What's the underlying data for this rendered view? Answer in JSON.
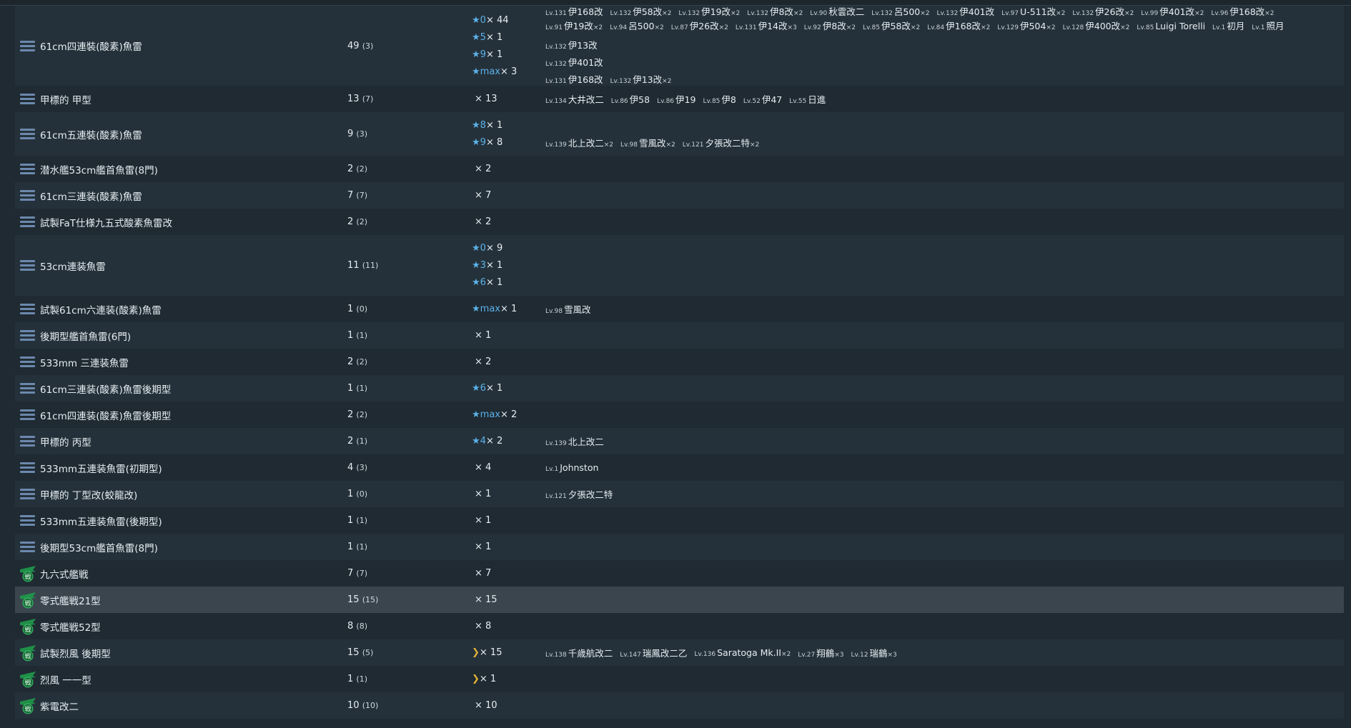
{
  "rows": [
    {
      "icon": "torpedo",
      "name": "61cm四連裝(酸素)魚雷",
      "count": "49",
      "paren": "(3)",
      "height": 112,
      "levels": [
        {
          "kind": "star",
          "level": "0",
          "mult": "44"
        },
        {
          "kind": "star",
          "level": "5",
          "mult": "1"
        },
        {
          "kind": "star",
          "level": "9",
          "mult": "1"
        },
        {
          "kind": "star",
          "level": "max",
          "mult": "3"
        }
      ],
      "ships": [
        [
          {
            "lv": "Lv.131",
            "name": "伊168改"
          },
          {
            "lv": "Lv.132",
            "name": "伊58改",
            "x": "×2"
          },
          {
            "lv": "Lv.132",
            "name": "伊19改",
            "x": "×2"
          },
          {
            "lv": "Lv.132",
            "name": "伊8改",
            "x": "×2"
          },
          {
            "lv": "Lv.90",
            "name": "秋雲改二"
          },
          {
            "lv": "Lv.132",
            "name": "呂500",
            "x": "×2"
          },
          {
            "lv": "Lv.132",
            "name": "伊401改"
          },
          {
            "lv": "Lv.97",
            "name": "U-511改",
            "x": "×2"
          },
          {
            "lv": "Lv.132",
            "name": "伊26改",
            "x": "×2"
          },
          {
            "lv": "Lv.99",
            "name": "伊401改",
            "x": "×2"
          },
          {
            "lv": "Lv.96",
            "name": "伊168改",
            "x": "×2"
          },
          {
            "lv": "Lv.91",
            "name": "伊19改",
            "x": "×2"
          },
          {
            "lv": "Lv.94",
            "name": "呂500",
            "x": "×2"
          },
          {
            "lv": "Lv.87",
            "name": "伊26改",
            "x": "×2"
          },
          {
            "lv": "Lv.131",
            "name": "伊14改",
            "x": "×3"
          },
          {
            "lv": "Lv.92",
            "name": "伊8改",
            "x": "×2"
          },
          {
            "lv": "Lv.85",
            "name": "伊58改",
            "x": "×2"
          },
          {
            "lv": "Lv.84",
            "name": "伊168改",
            "x": "×2"
          },
          {
            "lv": "Lv.129",
            "name": "伊504",
            "x": "×2"
          },
          {
            "lv": "Lv.128",
            "name": "伊400改",
            "x": "×2"
          },
          {
            "lv": "Lv.85",
            "name": "Luigi Torelli"
          },
          {
            "lv": "Lv.1",
            "name": "初月"
          },
          {
            "lv": "Lv.1",
            "name": "照月"
          }
        ],
        [
          {
            "lv": "Lv.132",
            "name": "伊13改"
          }
        ],
        [
          {
            "lv": "Lv.132",
            "name": "伊401改"
          }
        ],
        [
          {
            "lv": "Lv.131",
            "name": "伊168改"
          },
          {
            "lv": "Lv.132",
            "name": "伊13改",
            "x": "×2"
          }
        ]
      ]
    },
    {
      "icon": "torpedo",
      "name": "甲標的 甲型",
      "count": "13",
      "paren": "(7)",
      "height": 37,
      "levels": [
        {
          "kind": "plain",
          "level": "",
          "mult": "13"
        }
      ],
      "ships": [
        [
          {
            "lv": "Lv.134",
            "name": "大井改二"
          },
          {
            "lv": "Lv.86",
            "name": "伊58"
          },
          {
            "lv": "Lv.86",
            "name": "伊19"
          },
          {
            "lv": "Lv.85",
            "name": "伊8"
          },
          {
            "lv": "Lv.52",
            "name": "伊47"
          },
          {
            "lv": "Lv.55",
            "name": "日進"
          }
        ]
      ]
    },
    {
      "icon": "torpedo",
      "name": "61cm五連裝(酸素)魚雷",
      "count": "9",
      "paren": "(3)",
      "height": 61,
      "levels": [
        {
          "kind": "star",
          "level": "8",
          "mult": "1"
        },
        {
          "kind": "star",
          "level": "9",
          "mult": "8"
        }
      ],
      "ships": [
        [],
        [
          {
            "lv": "Lv.139",
            "name": "北上改二",
            "x": "×2"
          },
          {
            "lv": "Lv.98",
            "name": "雪風改",
            "x": "×2"
          },
          {
            "lv": "Lv.121",
            "name": "夕張改二特",
            "x": "×2"
          }
        ]
      ]
    },
    {
      "icon": "torpedo",
      "name": "潜水艦53cm艦首魚雷(8門)",
      "count": "2",
      "paren": "(2)",
      "height": 37,
      "levels": [
        {
          "kind": "plain",
          "level": "",
          "mult": "2"
        }
      ],
      "ships": [
        []
      ]
    },
    {
      "icon": "torpedo",
      "name": "61cm三連装(酸素)魚雷",
      "count": "7",
      "paren": "(7)",
      "height": 37,
      "levels": [
        {
          "kind": "plain",
          "level": "",
          "mult": "7"
        }
      ],
      "ships": [
        []
      ]
    },
    {
      "icon": "torpedo",
      "name": "試製FaT仕様九五式酸素魚雷改",
      "count": "2",
      "paren": "(2)",
      "height": 37,
      "levels": [
        {
          "kind": "plain",
          "level": "",
          "mult": "2"
        }
      ],
      "ships": [
        []
      ]
    },
    {
      "icon": "torpedo",
      "name": "53cm連装魚雷",
      "count": "11",
      "paren": "(11)",
      "height": 85,
      "levels": [
        {
          "kind": "star",
          "level": "0",
          "mult": "9"
        },
        {
          "kind": "star",
          "level": "3",
          "mult": "1"
        },
        {
          "kind": "star",
          "level": "6",
          "mult": "1"
        }
      ],
      "ships": [
        [],
        [],
        []
      ]
    },
    {
      "icon": "torpedo",
      "name": "試製61cm六連装(酸素)魚雷",
      "count": "1",
      "paren": "(0)",
      "height": 37,
      "levels": [
        {
          "kind": "star",
          "level": "max",
          "mult": "1"
        }
      ],
      "ships": [
        [
          {
            "lv": "Lv.98",
            "name": "雪風改"
          }
        ]
      ]
    },
    {
      "icon": "torpedo",
      "name": "後期型艦首魚雷(6門)",
      "count": "1",
      "paren": "(1)",
      "height": 37,
      "levels": [
        {
          "kind": "plain",
          "level": "",
          "mult": "1"
        }
      ],
      "ships": [
        []
      ]
    },
    {
      "icon": "torpedo",
      "name": "533mm 三連装魚雷",
      "count": "2",
      "paren": "(2)",
      "height": 37,
      "levels": [
        {
          "kind": "plain",
          "level": "",
          "mult": "2"
        }
      ],
      "ships": [
        []
      ]
    },
    {
      "icon": "torpedo",
      "name": "61cm三連装(酸素)魚雷後期型",
      "count": "1",
      "paren": "(1)",
      "height": 37,
      "levels": [
        {
          "kind": "star",
          "level": "6",
          "mult": "1"
        }
      ],
      "ships": [
        []
      ]
    },
    {
      "icon": "torpedo",
      "name": "61cm四連装(酸素)魚雷後期型",
      "count": "2",
      "paren": "(2)",
      "height": 37,
      "levels": [
        {
          "kind": "star",
          "level": "max",
          "mult": "2"
        }
      ],
      "ships": [
        []
      ]
    },
    {
      "icon": "torpedo",
      "name": "甲標的 丙型",
      "count": "2",
      "paren": "(1)",
      "height": 37,
      "levels": [
        {
          "kind": "star",
          "level": "4",
          "mult": "2"
        }
      ],
      "ships": [
        [
          {
            "lv": "Lv.139",
            "name": "北上改二"
          }
        ]
      ]
    },
    {
      "icon": "torpedo",
      "name": "533mm五連装魚雷(初期型)",
      "count": "4",
      "paren": "(3)",
      "height": 37,
      "levels": [
        {
          "kind": "plain",
          "level": "",
          "mult": "4"
        }
      ],
      "ships": [
        [
          {
            "lv": "Lv.1",
            "name": "Johnston"
          }
        ]
      ]
    },
    {
      "icon": "torpedo",
      "name": "甲標的 丁型改(蛟龍改)",
      "count": "1",
      "paren": "(0)",
      "height": 37,
      "levels": [
        {
          "kind": "plain",
          "level": "",
          "mult": "1"
        }
      ],
      "ships": [
        [
          {
            "lv": "Lv.121",
            "name": "夕張改二特"
          }
        ]
      ]
    },
    {
      "icon": "torpedo",
      "name": "533mm五連装魚雷(後期型)",
      "count": "1",
      "paren": "(1)",
      "height": 37,
      "levels": [
        {
          "kind": "plain",
          "level": "",
          "mult": "1"
        }
      ],
      "ships": [
        []
      ]
    },
    {
      "icon": "torpedo",
      "name": "後期型53cm艦首魚雷(8門)",
      "count": "1",
      "paren": "(1)",
      "height": 37,
      "levels": [
        {
          "kind": "plain",
          "level": "",
          "mult": "1"
        }
      ],
      "ships": [
        []
      ]
    },
    {
      "icon": "fighter",
      "name": "九六式艦戦",
      "count": "7",
      "paren": "(7)",
      "height": 37,
      "levels": [
        {
          "kind": "plain",
          "level": "",
          "mult": "7"
        }
      ],
      "ships": [
        []
      ]
    },
    {
      "icon": "fighter",
      "name": "零式艦戦21型",
      "count": "15",
      "paren": "(15)",
      "height": 37,
      "hover": true,
      "levels": [
        {
          "kind": "plain",
          "level": "",
          "mult": "15"
        }
      ],
      "ships": [
        []
      ]
    },
    {
      "icon": "fighter",
      "name": "零式艦戦52型",
      "count": "8",
      "paren": "(8)",
      "height": 37,
      "levels": [
        {
          "kind": "plain",
          "level": "",
          "mult": "8"
        }
      ],
      "ships": [
        []
      ]
    },
    {
      "icon": "fighter",
      "name": "試製烈風 後期型",
      "count": "15",
      "paren": "(5)",
      "height": 37,
      "levels": [
        {
          "kind": "chevron",
          "level": "",
          "mult": "15"
        }
      ],
      "ships": [
        [
          {
            "lv": "Lv.138",
            "name": "千歳航改二"
          },
          {
            "lv": "Lv.147",
            "name": "瑞鳳改二乙"
          },
          {
            "lv": "Lv.136",
            "name": "Saratoga Mk.II",
            "x": "×2"
          },
          {
            "lv": "Lv.27",
            "name": "翔鶴",
            "x": "×3"
          },
          {
            "lv": "Lv.12",
            "name": "瑞鶴",
            "x": "×3"
          }
        ]
      ]
    },
    {
      "icon": "fighter",
      "name": "烈風 一一型",
      "count": "1",
      "paren": "(1)",
      "height": 37,
      "levels": [
        {
          "kind": "chevron",
          "level": "",
          "mult": "1"
        }
      ],
      "ships": [
        []
      ]
    },
    {
      "icon": "fighter",
      "name": "紫電改二",
      "count": "10",
      "paren": "(10)",
      "height": 37,
      "levels": [
        {
          "kind": "plain",
          "level": "",
          "mult": "10"
        }
      ],
      "ships": [
        []
      ]
    }
  ],
  "icon_glyph": {
    "fighter": "戦"
  },
  "colors": {
    "bg": "#1f2a32",
    "row_alt": "#25313a",
    "hover": "#3a454e",
    "star": "#5bb2ea",
    "chevron": "#e0b136",
    "torpedo_icon": "#6c89ad",
    "fighter_icon": "#1f9a4a"
  }
}
